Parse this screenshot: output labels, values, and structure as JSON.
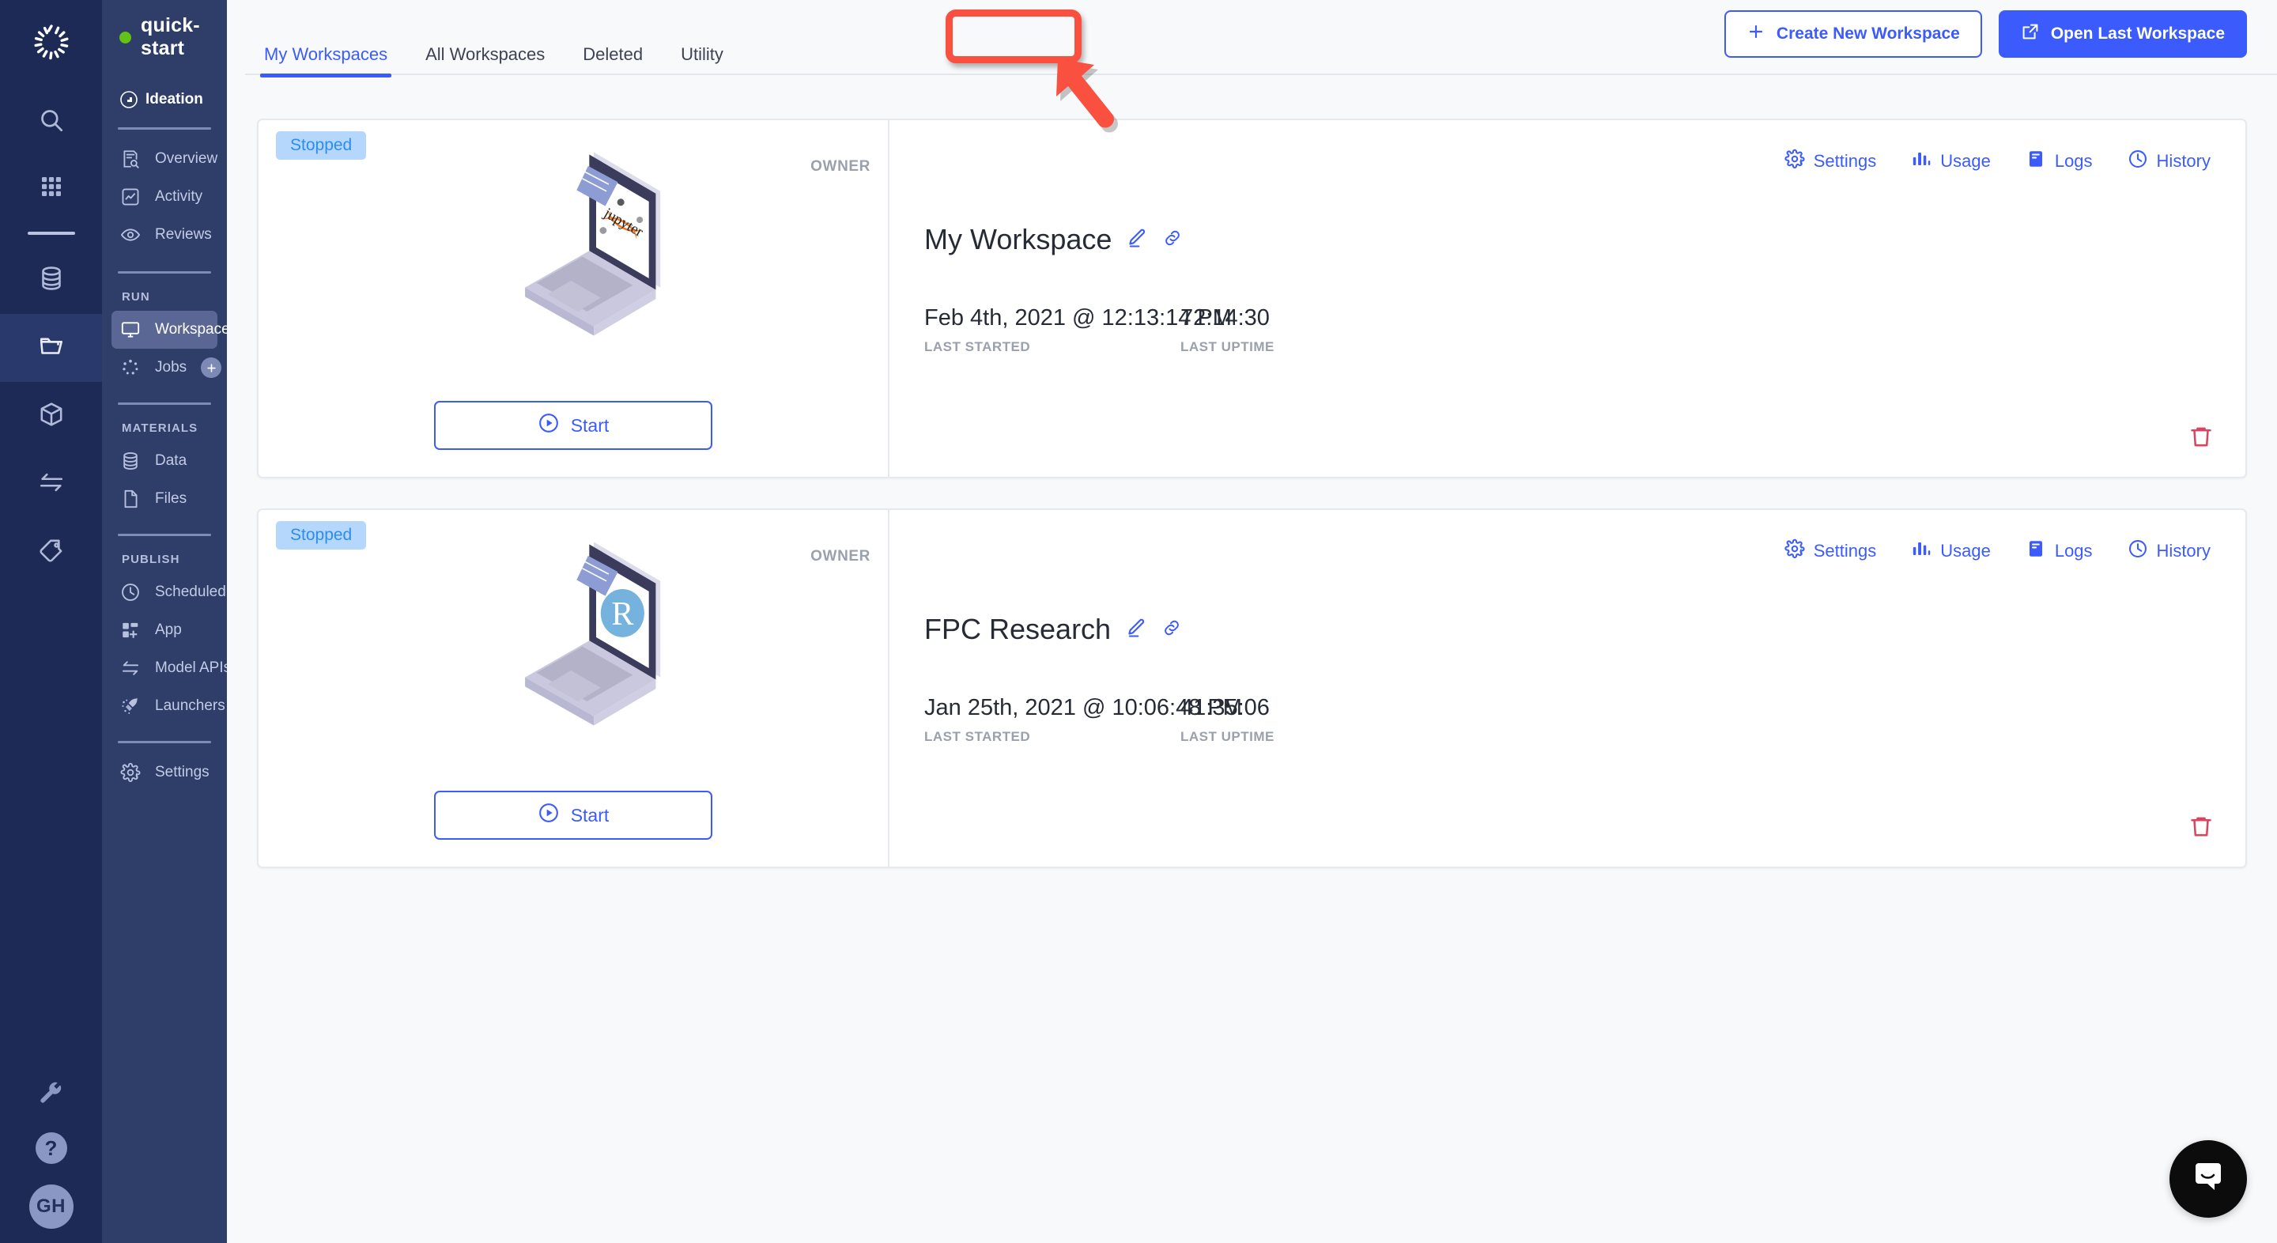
{
  "rail": {
    "logo_icon": "aperture-logo-icon",
    "items": [
      {
        "icon": "search-icon",
        "name": "search"
      },
      {
        "icon": "grid-apps-icon",
        "name": "apps"
      },
      {
        "icon": "database-icon",
        "name": "data"
      },
      {
        "icon": "folder-open-icon",
        "name": "projects",
        "active": true
      },
      {
        "icon": "cube-icon",
        "name": "models"
      },
      {
        "icon": "transfer-arrows-icon",
        "name": "transfer"
      },
      {
        "icon": "tag-icon",
        "name": "tags"
      }
    ],
    "bottom": [
      {
        "icon": "wrench-icon",
        "name": "tools"
      },
      {
        "icon": "help-icon",
        "name": "help",
        "label": "?"
      }
    ],
    "avatar_initials": "GH"
  },
  "sidebar": {
    "project_name": "quick-start",
    "status_color": "#62c316",
    "space_name": "Ideation",
    "space_icon": "ideation-icon",
    "top_items": [
      {
        "label": "Overview",
        "icon": "overview-icon"
      },
      {
        "label": "Activity",
        "icon": "activity-icon"
      },
      {
        "label": "Reviews",
        "icon": "eye-icon"
      }
    ],
    "sections": [
      {
        "title": "RUN",
        "items": [
          {
            "label": "Workspaces",
            "icon": "monitor-icon",
            "active": true,
            "badge": "chevron-right-icon"
          },
          {
            "label": "Jobs",
            "icon": "jobs-dots-icon",
            "badge": "plus-icon"
          }
        ]
      },
      {
        "title": "MATERIALS",
        "items": [
          {
            "label": "Data",
            "icon": "database-icon"
          },
          {
            "label": "Files",
            "icon": "file-icon"
          }
        ]
      },
      {
        "title": "PUBLISH",
        "items": [
          {
            "label": "Scheduled Jobs",
            "icon": "clock-icon"
          },
          {
            "label": "App",
            "icon": "app-blocks-icon"
          },
          {
            "label": "Model APIs",
            "icon": "transfer-arrows-icon"
          },
          {
            "label": "Launchers",
            "icon": "rocket-icon"
          }
        ]
      }
    ],
    "settings": {
      "label": "Settings",
      "icon": "gear-icon"
    }
  },
  "topbar": {
    "tabs": [
      {
        "label": "My Workspaces",
        "active": true
      },
      {
        "label": "All Workspaces",
        "active": false
      },
      {
        "label": "Deleted",
        "active": false
      },
      {
        "label": "Utility",
        "active": false,
        "highlighted": true
      }
    ],
    "create_button": {
      "label": "Create New Workspace",
      "icon": "plus-icon"
    },
    "open_button": {
      "label": "Open Last Workspace",
      "icon": "external-link-icon"
    }
  },
  "cards": [
    {
      "status": "Stopped",
      "role": "OWNER",
      "kernel": "jupyter",
      "start_label": "Start",
      "start_icon": "play-circle-icon",
      "title": "My Workspace",
      "edit_icon": "pencil-icon",
      "link_icon": "link-icon",
      "last_started_value": "Feb 4th, 2021 @ 12:13:14 PM",
      "last_started_label": "LAST STARTED",
      "last_uptime_value": "72:14:30",
      "last_uptime_label": "LAST UPTIME",
      "actions": [
        {
          "label": "Settings",
          "icon": "gear-icon"
        },
        {
          "label": "Usage",
          "icon": "bar-chart-icon"
        },
        {
          "label": "Logs",
          "icon": "logs-icon"
        },
        {
          "label": "History",
          "icon": "clock-icon"
        }
      ],
      "delete_icon": "trash-icon"
    },
    {
      "status": "Stopped",
      "role": "OWNER",
      "kernel": "rstudio",
      "kernel_letter": "R",
      "start_label": "Start",
      "start_icon": "play-circle-icon",
      "title": "FPC Research",
      "edit_icon": "pencil-icon",
      "link_icon": "link-icon",
      "last_started_value": "Jan 25th, 2021 @ 10:06:48 PM",
      "last_started_label": "LAST STARTED",
      "last_uptime_value": "41:35:06",
      "last_uptime_label": "LAST UPTIME",
      "actions": [
        {
          "label": "Settings",
          "icon": "gear-icon"
        },
        {
          "label": "Usage",
          "icon": "bar-chart-icon"
        },
        {
          "label": "Logs",
          "icon": "logs-icon"
        },
        {
          "label": "History",
          "icon": "clock-icon"
        }
      ],
      "delete_icon": "trash-icon"
    }
  ],
  "annotation": {
    "color": "#f9503f",
    "target": "Utility",
    "arrow_icon": "arrow-pointer-icon"
  },
  "intercom": {
    "icon": "chat-bubble-icon"
  },
  "colors": {
    "accent": "#3b5bfd",
    "sidebar": "#2e3e68",
    "rail": "#1e2a56",
    "background": "#f8f9fb",
    "badge_bg": "#b5d7fb",
    "badge_text": "#2d8cf0",
    "danger": "#d9455f",
    "annotation": "#f9503f"
  }
}
